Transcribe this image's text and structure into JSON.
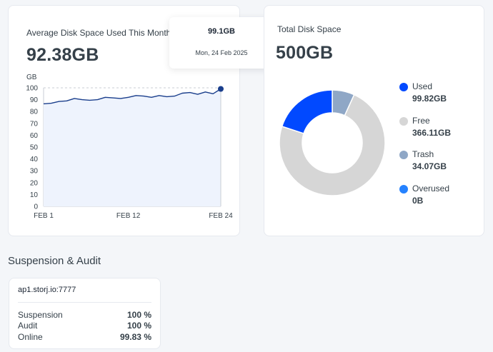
{
  "disk_used_card": {
    "title": "Average Disk Space Used This Month",
    "value": "92.38GB"
  },
  "tooltip": {
    "value": "99.1GB",
    "date": "Mon, 24 Feb 2025"
  },
  "total_card": {
    "title": "Total Disk Space",
    "value": "500GB"
  },
  "legend": [
    {
      "label": "Used",
      "value": "99.82GB",
      "color": "#0149ff"
    },
    {
      "label": "Free",
      "value": "366.11GB",
      "color": "#d6d6d6"
    },
    {
      "label": "Trash",
      "value": "34.07GB",
      "color": "#8fa7c6"
    },
    {
      "label": "Overused",
      "value": "0B",
      "color": "#2582ff"
    }
  ],
  "section_title": "Suspension & Audit",
  "node": {
    "address": "ap1.storj.io:7777",
    "stats": [
      {
        "label": "Suspension",
        "value": "100 %"
      },
      {
        "label": "Audit",
        "value": "100 %"
      },
      {
        "label": "Online",
        "value": "99.83 %"
      }
    ]
  },
  "chart_data": [
    {
      "type": "area",
      "ylabel": "GB",
      "ylim": [
        0,
        100
      ],
      "yticks": [
        0,
        10,
        20,
        30,
        40,
        50,
        60,
        70,
        80,
        90,
        100
      ],
      "xlim": [
        1,
        24
      ],
      "xticks": [
        1,
        12,
        24
      ],
      "xtick_labels": [
        "FEB 1",
        "FEB 12",
        "FEB 24"
      ],
      "reference_line": 100,
      "line_color": "#1a3e8c",
      "fill_color": "#eef3fd",
      "x": [
        1,
        2,
        3,
        4,
        5,
        6,
        7,
        8,
        9,
        10,
        11,
        12,
        13,
        14,
        15,
        16,
        17,
        18,
        19,
        20,
        21,
        22,
        23,
        24
      ],
      "values": [
        86.5,
        87.0,
        88.5,
        89.0,
        91.0,
        90.0,
        89.5,
        90.0,
        92.0,
        91.5,
        91.0,
        92.0,
        93.5,
        93.0,
        92.0,
        93.5,
        92.5,
        93.0,
        95.5,
        96.0,
        94.5,
        96.5,
        95.0,
        99.1
      ]
    },
    {
      "type": "pie",
      "categories": [
        "Used",
        "Free",
        "Trash",
        "Overused"
      ],
      "values": [
        99.82,
        366.11,
        34.07,
        0
      ],
      "colors": [
        "#0149ff",
        "#d6d6d6",
        "#8fa7c6",
        "#2582ff"
      ]
    }
  ]
}
